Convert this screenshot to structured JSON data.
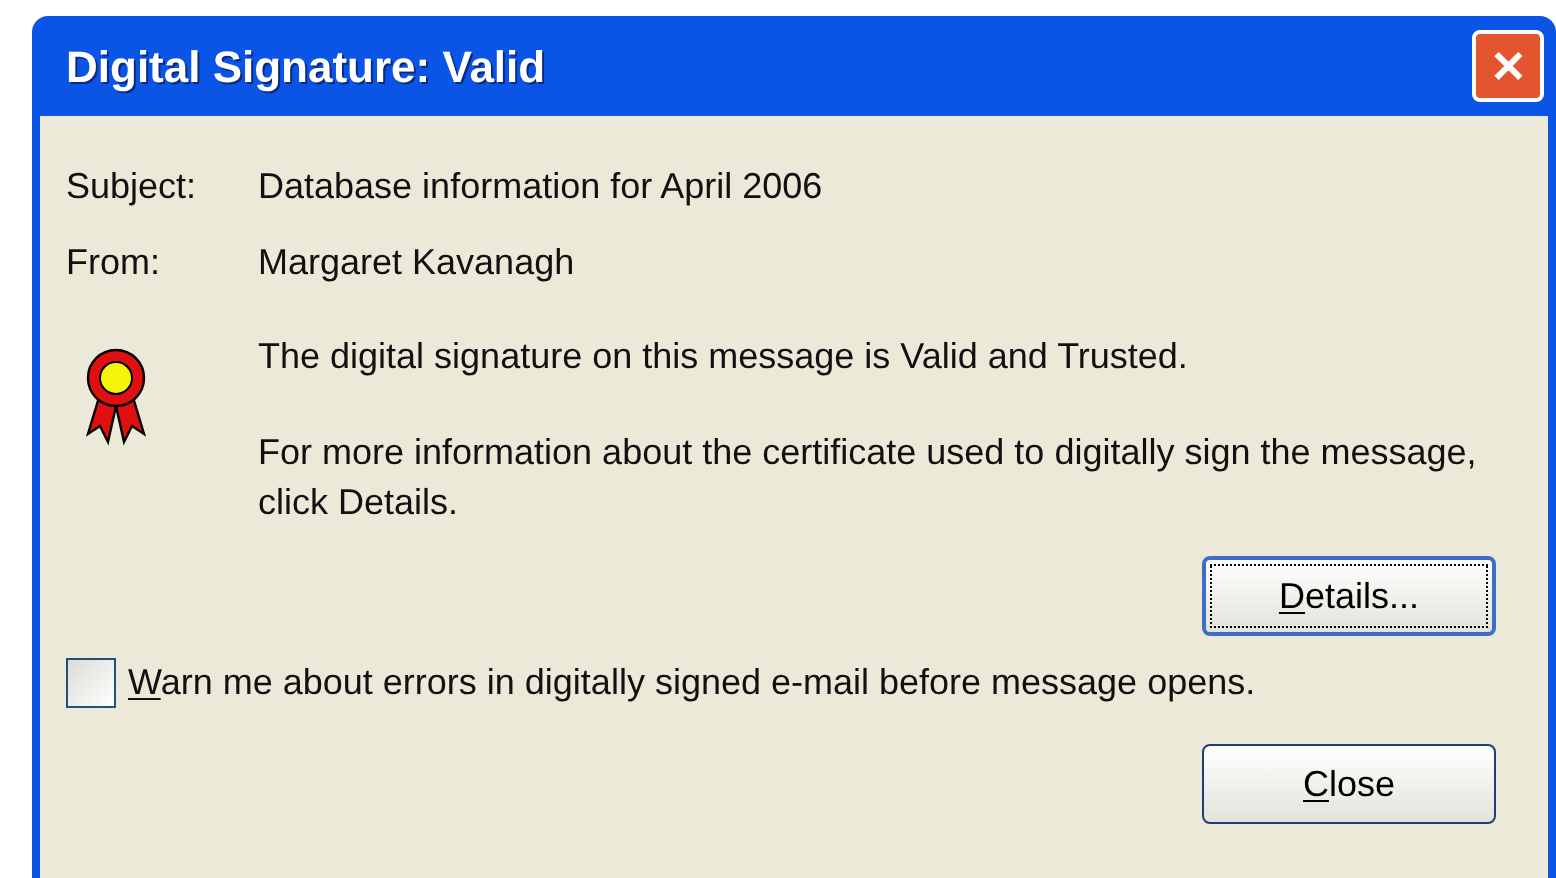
{
  "window": {
    "title": "Digital Signature: Valid",
    "close_glyph": "✕"
  },
  "fields": [
    {
      "label": "Subject:",
      "value": "Database information for April 2006"
    },
    {
      "label": "From:",
      "value": "Margaret Kavanagh"
    }
  ],
  "status": "The digital signature on this message is Valid and Trusted.",
  "info": "For more information about the certificate used to digitally sign the message, click Details.",
  "details_button": {
    "label_parts": [
      "D",
      "etails..."
    ],
    "focused": true
  },
  "warn_checkbox": {
    "label_parts": [
      "W",
      "arn me about errors in digitally signed e-mail before message opens."
    ],
    "checked": false
  },
  "close_button": {
    "label_parts": [
      "C",
      "lose"
    ],
    "focused": false
  }
}
